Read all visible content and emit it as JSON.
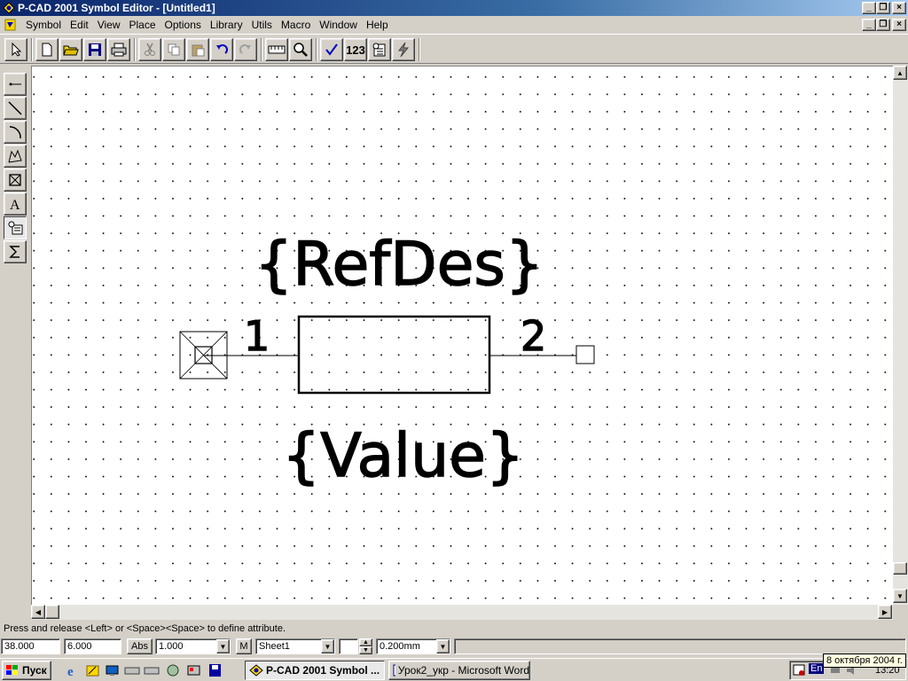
{
  "window": {
    "title": "P-CAD 2001 Symbol Editor - [Untitled1]",
    "controls": [
      "_",
      "❐",
      "×"
    ]
  },
  "menu": {
    "items": [
      {
        "label": "Symbol",
        "hotkey": "S"
      },
      {
        "label": "Edit",
        "hotkey": "E"
      },
      {
        "label": "View",
        "hotkey": "V"
      },
      {
        "label": "Place",
        "hotkey": "P"
      },
      {
        "label": "Options",
        "hotkey": "O"
      },
      {
        "label": "Library",
        "hotkey": "L"
      },
      {
        "label": "Utils",
        "hotkey": "U"
      },
      {
        "label": "Macro",
        "hotkey": "M"
      },
      {
        "label": "Window",
        "hotkey": "W"
      },
      {
        "label": "Help",
        "hotkey": "H"
      }
    ]
  },
  "toolbar": {
    "validate_label": "123"
  },
  "left_tools": [
    "pin-tool",
    "line-tool",
    "arc-tool",
    "polygon-tool",
    "ref-point-tool",
    "text-tool",
    "attribute-tool",
    "ieee-symbol-tool"
  ],
  "canvas": {
    "refdes_text": "{RefDes}",
    "value_text": "{Value}",
    "pin1_label": "1",
    "pin2_label": "2"
  },
  "status": {
    "prompt": "Press and release <Left> or <Space><Space> to define attribute.",
    "x_coord": "38.000",
    "y_coord": "6.000",
    "abs_label": "Abs",
    "grid": "1.000",
    "m_label": "M",
    "sheet": "Sheet1",
    "line_width": "0.200mm"
  },
  "taskbar": {
    "start_label": "Пуск",
    "tasks": [
      {
        "label": "P-CAD 2001 Symbol ...",
        "active": true
      },
      {
        "label": "Урок2_укр - Microsoft Word",
        "active": false
      }
    ],
    "tray_lang": "En",
    "tray_time": "13:20",
    "date_tooltip": "8 октября 2004 г."
  },
  "colors": {
    "title_start": "#0a246a",
    "title_end": "#a6caf0",
    "face": "#d4d0c8",
    "canvas": "#ffffff"
  }
}
